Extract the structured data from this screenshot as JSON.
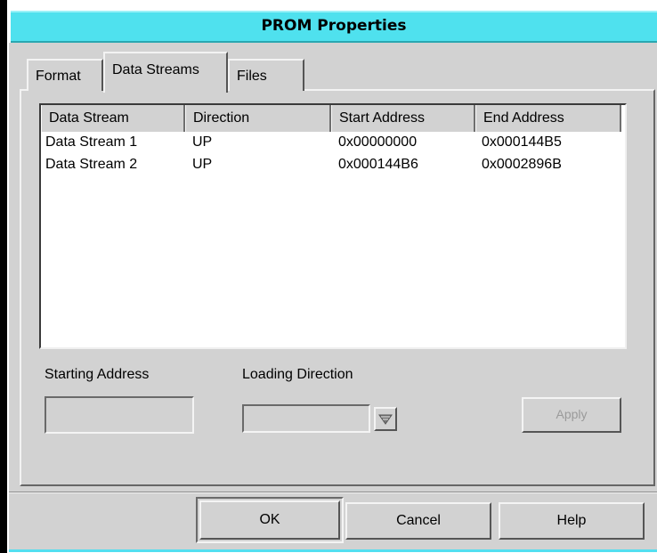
{
  "window": {
    "title": "PROM Properties"
  },
  "tabs": [
    {
      "label": "Format"
    },
    {
      "label": "Data Streams"
    },
    {
      "label": "Files"
    }
  ],
  "table": {
    "columns": [
      "Data Stream",
      "Direction",
      "Start Address",
      "End Address"
    ],
    "rows": [
      [
        "Data Stream 1",
        "UP",
        "0x00000000",
        "0x000144B5"
      ],
      [
        "Data Stream 2",
        "UP",
        "0x000144B6",
        "0x0002896B"
      ]
    ]
  },
  "starting_address": {
    "label": "Starting Address",
    "value": ""
  },
  "loading_direction": {
    "label": "Loading Direction",
    "value": "",
    "icon": "dropdown-arrow-icon"
  },
  "apply_button": {
    "label": "Apply"
  },
  "buttons": {
    "ok": "OK",
    "cancel": "Cancel",
    "help": "Help"
  }
}
